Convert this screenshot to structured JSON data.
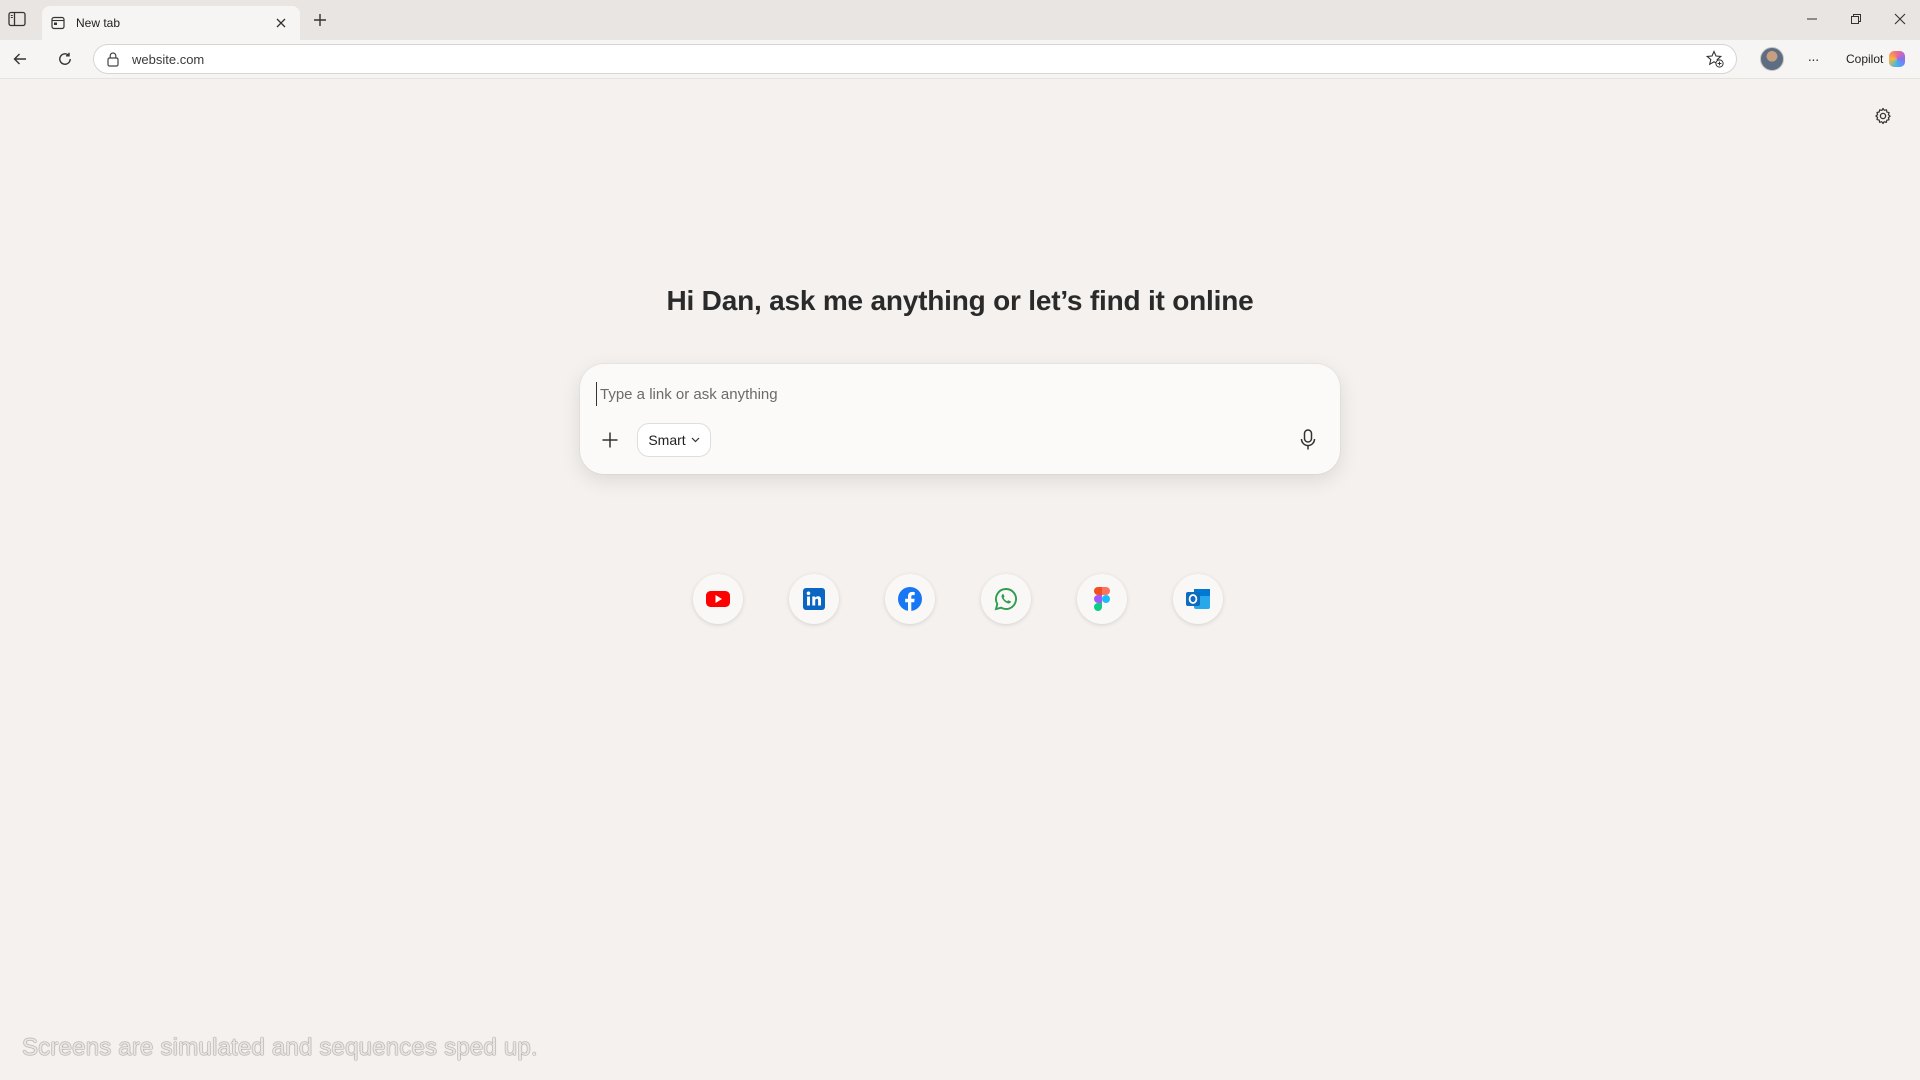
{
  "window": {
    "tab_title": "New tab",
    "new_tab_symbol": "+"
  },
  "toolbar": {
    "address_value": "website.com",
    "copilot_label": "Copilot",
    "more_symbol": "···"
  },
  "page": {
    "greeting": "Hi Dan, ask me anything or let’s find it online",
    "composer": {
      "placeholder": "Type a link or ask anything",
      "mode_label": "Smart"
    },
    "quick_links": [
      {
        "name": "youtube-icon",
        "color": "#ff0000"
      },
      {
        "name": "linkedin-icon",
        "color": "#0a66c2"
      },
      {
        "name": "facebook-icon",
        "color": "#1877f2"
      },
      {
        "name": "whatsapp-icon",
        "color": "#25d366"
      },
      {
        "name": "figma-icon",
        "color": "#a259ff"
      },
      {
        "name": "outlook-icon",
        "color": "#0f6cbd"
      }
    ]
  },
  "overlay": {
    "disclaimer": "Screens are simulated and sequences sped up."
  },
  "colors": {
    "page_background": "#f4f1ee",
    "titlebar": "#e9e5e2",
    "accent": "#0f6cbd"
  }
}
